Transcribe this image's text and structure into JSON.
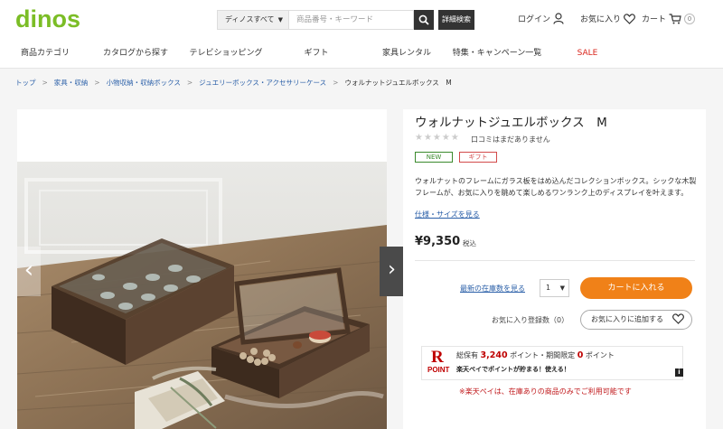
{
  "header": {
    "logo": "dinos",
    "search_category": "ディノスすべて",
    "search_placeholder": "商品番号・キーワード",
    "advanced_search": "詳細検索",
    "login": "ログイン",
    "favorites": "お気に入り",
    "cart": "カート",
    "cart_count": "0"
  },
  "nav": {
    "items": [
      {
        "label": "商品カテゴリ"
      },
      {
        "label": "カタログから探す"
      },
      {
        "label": "テレビショッピング"
      },
      {
        "label": "ギフト"
      },
      {
        "label": "家具レンタル"
      },
      {
        "label": "特集・キャンペーン一覧"
      },
      {
        "label": "SALE"
      }
    ]
  },
  "breadcrumb": {
    "items": [
      "トップ",
      "家具・収納",
      "小物収納・収納ボックス",
      "ジュエリーボックス・アクセサリーケース"
    ],
    "current": "ウォルナットジュエルボックス　M",
    "separator": ">"
  },
  "product": {
    "title": "ウォルナットジュエルボックス　M",
    "stars": "★★★★★",
    "reviews": "口コミはまだありません",
    "badges": {
      "new": "NEW",
      "gift": "ギフト"
    },
    "description": "ウォルナットのフレームにガラス板をはめ込んだコレクションボックス。シックな木製フレームが、お気に入りを眺めて楽しめるワンランク上のディスプレイを叶えます。",
    "spec_link": "仕様・サイズを見る",
    "price": "¥9,350",
    "tax_label": "税込",
    "stock_link": "最新の在庫数を見る",
    "quantity": "1",
    "add_to_cart": "カートに入れる",
    "fav_count": "お気に入り登録数（0）",
    "add_to_fav": "お気に入りに追加する"
  },
  "rakuten": {
    "logo_r": "R",
    "logo_text": "POINT",
    "line1_prefix": "総保有",
    "points_total": "3,240",
    "line1_mid": "ポイント・期間限定",
    "points_limited": "0",
    "line1_suffix": "ポイント",
    "line2": "楽天ペイでポイントが貯まる！使える！",
    "info": "i",
    "note": "※楽天ペイは、在庫ありの商品のみでご利用可能です"
  },
  "gallery": {
    "prev": "‹",
    "next": "›"
  },
  "colors": {
    "brand": "#7bbd26",
    "cart_button": "#f08118",
    "link": "#2a5fa8",
    "sale": "#d9241b",
    "rakuten": "#bf0000"
  }
}
